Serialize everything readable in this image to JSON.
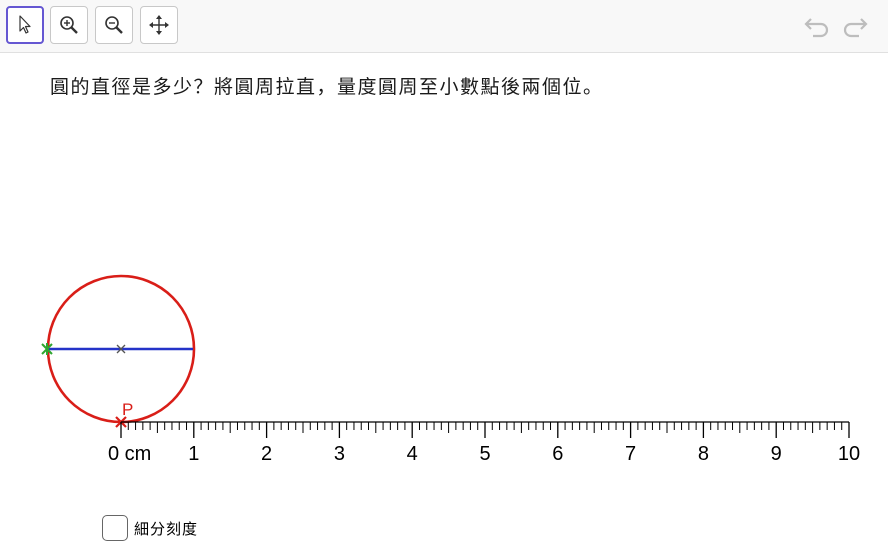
{
  "toolbar": {
    "tools": [
      {
        "name": "move-tool-button",
        "icon": "cursor-arrow-icon",
        "active": true
      },
      {
        "name": "zoom-in-button",
        "icon": "zoom-in-icon",
        "active": false
      },
      {
        "name": "zoom-out-button",
        "icon": "zoom-out-icon",
        "active": false
      },
      {
        "name": "pan-view-button",
        "icon": "move-arrows-icon",
        "active": false
      }
    ],
    "undo_icon": "undo-icon",
    "redo_icon": "redo-icon"
  },
  "question": "圓的直徑是多少？將圓周拉直，量度圓周至小數點後兩個位。",
  "ruler": {
    "unit": "cm",
    "min": 0,
    "max": 10,
    "minor_divisions": 10,
    "labels": [
      "0 cm",
      "1",
      "2",
      "3",
      "4",
      "5",
      "6",
      "7",
      "8",
      "9",
      "10"
    ]
  },
  "circle": {
    "diameter_cm": 2,
    "color": "#d91e18",
    "diameter_color": "#2433c8",
    "point_label": "P"
  },
  "options": {
    "fine_ticks_label": "細分刻度",
    "fine_ticks_checked": false
  }
}
